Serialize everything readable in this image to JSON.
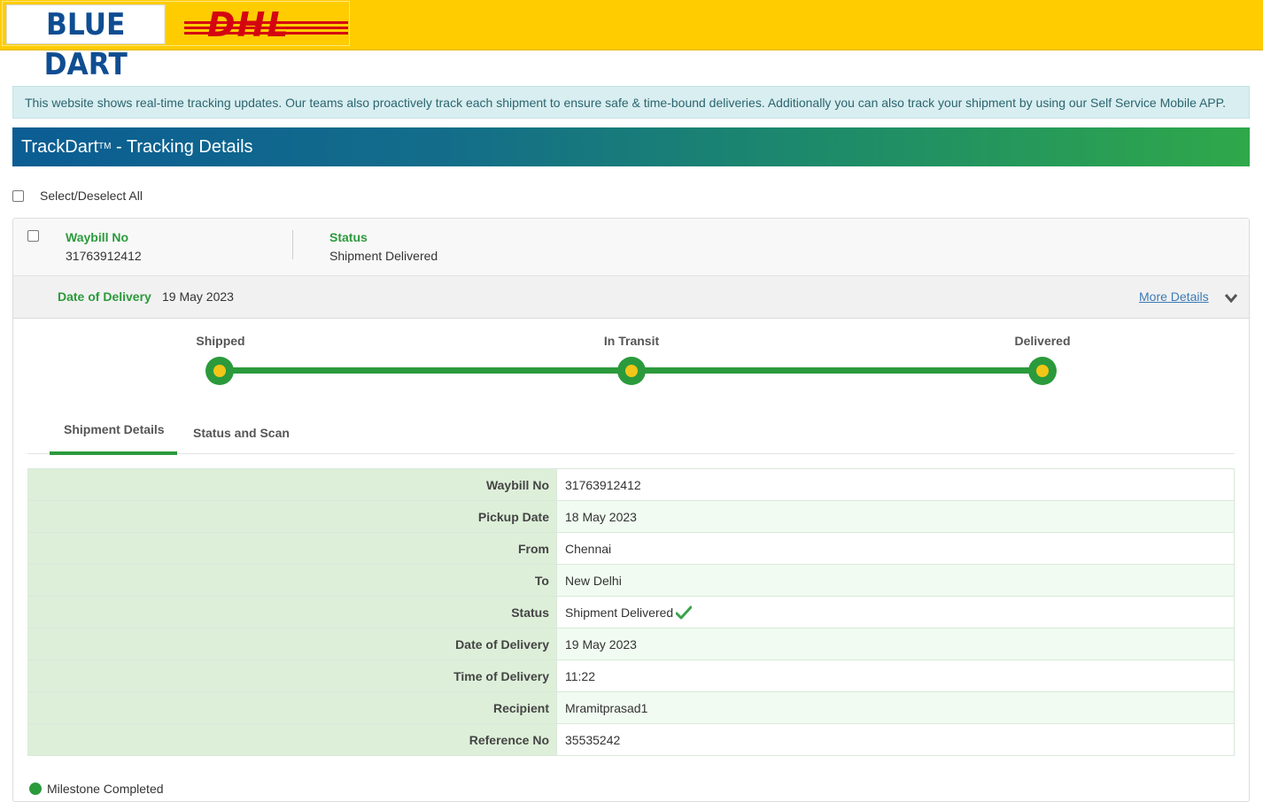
{
  "brand": {
    "bluedart_logo": "BLUE DART",
    "dhl_logo": "DHL",
    "colors": {
      "yellow": "#ffcc00",
      "dhl_red": "#d40511",
      "bluedart_blue": "#0f4d92",
      "accent_green": "#2b9a3c"
    }
  },
  "banner": {
    "text": "This website shows real-time tracking updates. Our teams also proactively track each shipment to ensure safe & time-bound deliveries. Additionally you can also track your shipment by using our Self Service Mobile APP."
  },
  "header": {
    "title": "TrackDart",
    "tm": "TM",
    "suffix": " - Tracking Details"
  },
  "select_all": {
    "label": "Select/Deselect All"
  },
  "shipment": {
    "waybill_label": "Waybill No",
    "waybill_value": "31763912412",
    "status_label": "Status",
    "status_value": "Shipment Delivered",
    "dod_label": "Date of Delivery",
    "dod_value": "19 May 2023",
    "more_details": "More Details",
    "stages": [
      {
        "label": "Shipped"
      },
      {
        "label": "In Transit"
      },
      {
        "label": "Delivered"
      }
    ],
    "tabs": [
      {
        "label": "Shipment Details",
        "active": true
      },
      {
        "label": "Status and Scan",
        "active": false
      }
    ],
    "details": [
      {
        "key": "Waybill No",
        "value": "31763912412"
      },
      {
        "key": "Pickup Date",
        "value": "18 May 2023"
      },
      {
        "key": "From",
        "value": "Chennai"
      },
      {
        "key": "To",
        "value": "New Delhi"
      },
      {
        "key": "Status",
        "value": "Shipment Delivered"
      },
      {
        "key": "Date of Delivery",
        "value": "19 May 2023"
      },
      {
        "key": "Time of Delivery",
        "value": "11:22"
      },
      {
        "key": "Recipient",
        "value": "Mramitprasad1"
      },
      {
        "key": "Reference No",
        "value": "35535242"
      }
    ],
    "milestone_label": "Milestone Completed"
  }
}
